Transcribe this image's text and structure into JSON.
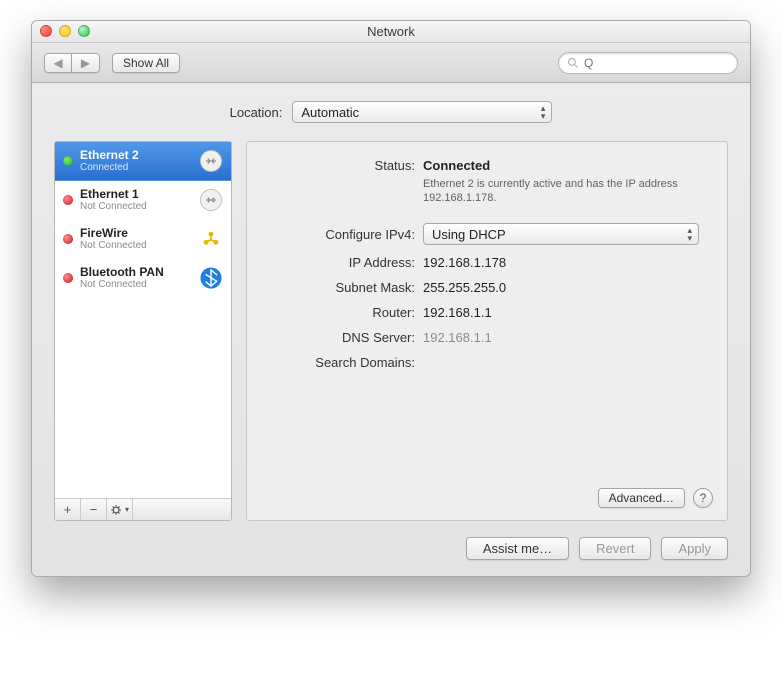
{
  "window": {
    "title": "Network"
  },
  "toolbar": {
    "back_label": "◀",
    "forward_label": "▶",
    "show_all_label": "Show All",
    "search_placeholder": "Q"
  },
  "location": {
    "label": "Location:",
    "value": "Automatic"
  },
  "services": [
    {
      "name": "Ethernet 2",
      "status": "Connected",
      "dot": "green",
      "icon": "ethernet",
      "selected": true
    },
    {
      "name": "Ethernet 1",
      "status": "Not Connected",
      "dot": "red",
      "icon": "ethernet",
      "selected": false
    },
    {
      "name": "FireWire",
      "status": "Not Connected",
      "dot": "red",
      "icon": "firewire",
      "selected": false
    },
    {
      "name": "Bluetooth PAN",
      "status": "Not Connected",
      "dot": "red",
      "icon": "bluetooth",
      "selected": false
    }
  ],
  "sidebar_footer": {
    "add": "+",
    "remove": "−",
    "gear": "✻▾"
  },
  "detail": {
    "status_label": "Status:",
    "status_value": "Connected",
    "status_note": "Ethernet 2 is currently active and has the IP address 192.168.1.178.",
    "configure_label": "Configure IPv4:",
    "configure_value": "Using DHCP",
    "ip_label": "IP Address:",
    "ip_value": "192.168.1.178",
    "subnet_label": "Subnet Mask:",
    "subnet_value": "255.255.255.0",
    "router_label": "Router:",
    "router_value": "192.168.1.1",
    "dns_label": "DNS Server:",
    "dns_value": "192.168.1.1",
    "search_label": "Search Domains:",
    "search_value": "",
    "advanced_label": "Advanced…",
    "help_label": "?"
  },
  "footer": {
    "assist_label": "Assist me…",
    "revert_label": "Revert",
    "apply_label": "Apply"
  }
}
